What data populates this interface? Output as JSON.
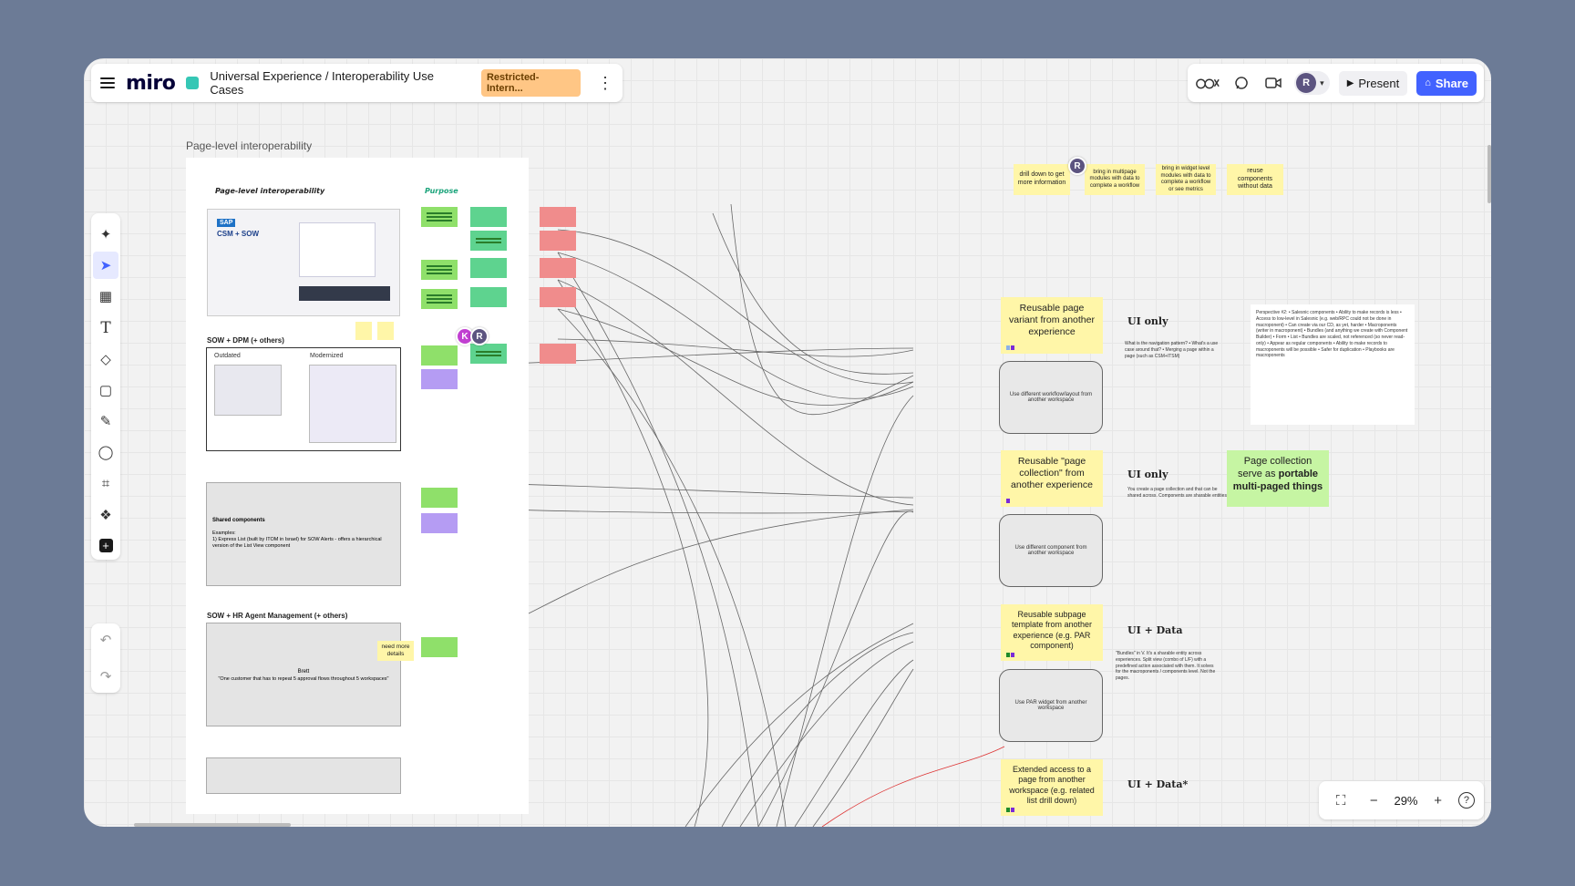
{
  "header": {
    "logo": "miro",
    "board_title": "Universal Experience / Interoperability Use Cases",
    "badge": "Restricted-Intern...",
    "more": "⋮"
  },
  "right": {
    "avatar": "R",
    "present": "Present",
    "share": "Share"
  },
  "zoom": {
    "value": "29%"
  },
  "canvas": {
    "frame_label": "Page-level interoperability",
    "frame_heading": "Page-level interoperability",
    "purpose_heading": "Purpose",
    "section_dpm": "SOW + DPM (+ others)",
    "slide2_left": "Outdated",
    "slide2_right": "Modernized",
    "slide1_brand": "SAP",
    "slide1_title": "CSM + SOW",
    "shared_components_title": "Shared components",
    "shared_components_examples": "Examples:",
    "shared_components_item": "1) Express List (built by ITOM in Israel) for SOW Alerts - offers a hierarchical version of the List View component",
    "section_hr": "SOW + HR Agent Management (+ others)",
    "hr_brett": "Brett",
    "hr_quote": "\"One customer that has to repeat 5 approval flows throughout 5 workspaces\"",
    "need_more_details": "need more details",
    "cursor_k": "K",
    "cursor_r": "R",
    "cursor_top": "R"
  },
  "top_stickies": [
    "drill down to get more information",
    "bring in multipage modules with data to complete a workflow",
    "bring in widget level modules with data to complete a workflow or see metrics",
    "reuse components without data"
  ],
  "right_column": {
    "sticky1": "Reusable page variant from another experience",
    "label1": "UI only",
    "node1": "Use different workflow/layout from another workspace",
    "sticky2": "Reusable \"page collection\" from another experience",
    "label2": "UI only",
    "node2": "Use different component from another workspace",
    "sticky3": "Reusable subpage template from another experience (e.g. PAR component)",
    "label3": "UI + Data",
    "node3": "Use PAR widget from another workspace",
    "sticky4": "Extended access to a page from another workspace (e.g. related list drill down)",
    "label4": "UI + Data*",
    "green_sticky_pre": "Page collection serve as ",
    "green_sticky_bold": "portable multi-paged things",
    "note1": "What is the navigation pattern? • What's a use case around that? • Merging a page within a page (such as CSM+ITSM)",
    "note2": "You create a page collection and that can be shared across. Components are sharable entities",
    "note3": "\"Bundles\" in V. It's a sharable entity across experiences. Split view (combo of L/F) with a predefined action associated with them. It solves for the macroponents / components level. Not the pages.",
    "perspective": "Perspective #2: • Salesnic components • Ability to make records is less • Access to low-level in Salesnic (e.g. web/RPC could not be done in macroponent) • Can create via our CD, as yet, harder • Macroponents (writer in macroponent) • Bundles (and anything we create with Component Builder) • Form • List • Bundles are scaled, not referenced (so never read-only) • Appear as regular components • Ability to make records to macroponents will be possible • Safer for duplication • Playbooks are macroponents"
  },
  "colors": {
    "background": "#6c7b96",
    "accent": "#4262ff",
    "badge": "#ffc685",
    "sticky_yellow": "#fff6a8",
    "sticky_green": "#8fe06a",
    "sticky_pink": "#f08c8c",
    "sticky_purple": "#b59cf3"
  },
  "icons": {
    "toolbar": [
      "sparkle-icon",
      "select-cursor-icon",
      "table-icon",
      "text-icon",
      "shapes-icon",
      "sticky-note-icon",
      "pen-icon",
      "comment-icon",
      "frame-icon",
      "templates-icon",
      "add-icon"
    ]
  }
}
